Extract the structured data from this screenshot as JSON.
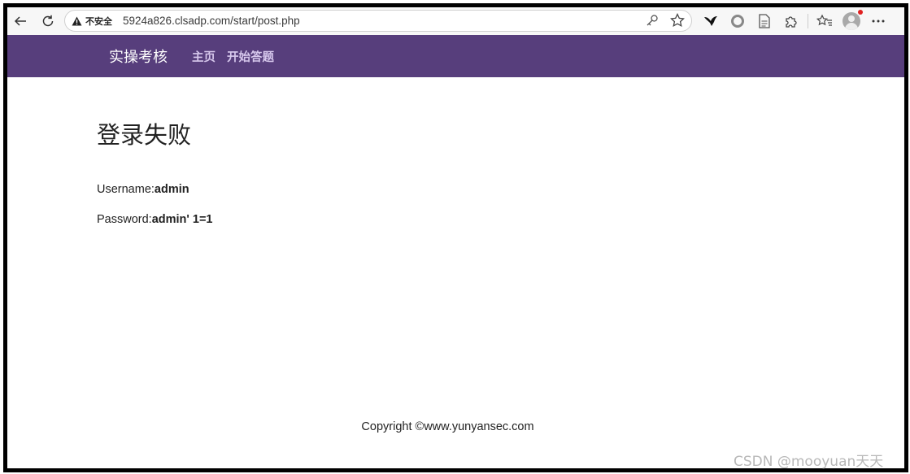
{
  "browser": {
    "security_label": "不安全",
    "url": "5924a826.clsadp.com/start/post.php",
    "icons": [
      "back-arrow-icon",
      "refresh-icon",
      "warning-triangle-icon",
      "key-icon",
      "star-icon",
      "bird-extension-icon",
      "circle-extension-icon",
      "document-icon",
      "puzzle-extension-icon",
      "favorites-icon",
      "profile-avatar",
      "more-icon"
    ],
    "notification_color": "#e02020"
  },
  "navbar": {
    "brand": "实操考核",
    "links": [
      {
        "label": "主页"
      },
      {
        "label": "开始答题"
      }
    ],
    "bg_color": "#573e7c",
    "link_color": "#d6c7ec"
  },
  "main": {
    "title": "登录失败",
    "username_label": "Username:",
    "username_value": "admin",
    "password_label": "Password:",
    "password_value": "admin' 1=1"
  },
  "footer": {
    "copyright": "Copyright ©www.yunyansec.com"
  },
  "watermark": "CSDN @mooyuan天天"
}
